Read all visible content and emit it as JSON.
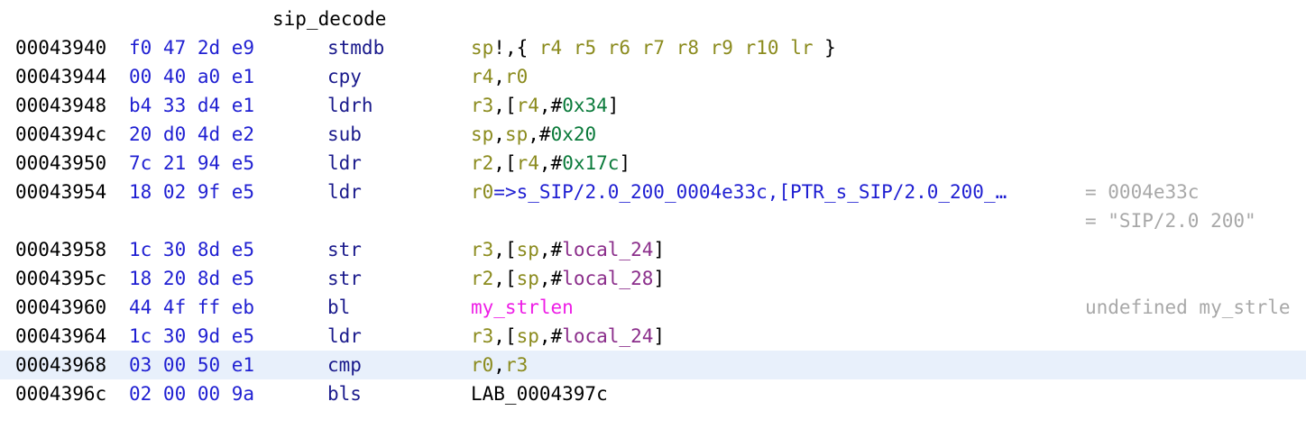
{
  "function_name": "sip_decode",
  "rows": [
    {
      "addr": "00043940",
      "bytes": "f0 47 2d e9",
      "mnemonic": "stmdb"
    },
    {
      "addr": "00043944",
      "bytes": "00 40 a0 e1",
      "mnemonic": "cpy"
    },
    {
      "addr": "00043948",
      "bytes": "b4 33 d4 e1",
      "mnemonic": "ldrh"
    },
    {
      "addr": "0004394c",
      "bytes": "20 d0 4d e2",
      "mnemonic": "sub"
    },
    {
      "addr": "00043950",
      "bytes": "7c 21 94 e5",
      "mnemonic": "ldr"
    },
    {
      "addr": "00043954",
      "bytes": "18 02 9f e5",
      "mnemonic": "ldr",
      "comment": "= 0004e33c",
      "comment2": "= \"SIP/2.0 200\""
    },
    {
      "addr": "00043958",
      "bytes": "1c 30 8d e5",
      "mnemonic": "str"
    },
    {
      "addr": "0004395c",
      "bytes": "18 20 8d e5",
      "mnemonic": "str"
    },
    {
      "addr": "00043960",
      "bytes": "44 4f ff eb",
      "mnemonic": "bl",
      "comment": "undefined my_strle"
    },
    {
      "addr": "00043964",
      "bytes": "1c 30 9d e5",
      "mnemonic": "ldr"
    },
    {
      "addr": "00043968",
      "bytes": "03 00 50 e1",
      "mnemonic": "cmp"
    },
    {
      "addr": "0004396c",
      "bytes": "02 00 00 9a",
      "mnemonic": "bls"
    }
  ],
  "operands": {
    "stmdb_base": "sp",
    "stmdb_bang": "!,{ ",
    "stmdb_regs": [
      "r4",
      "r5",
      "r6",
      "r7",
      "r8",
      "r9",
      "r10",
      "lr"
    ],
    "stmdb_close": " }",
    "r0": "r0",
    "r2": "r2",
    "r3": "r3",
    "r4": "r4",
    "sp": "sp",
    "comma": ",",
    "lbracket": "[",
    "rbracket": "]",
    "hash": "#",
    "imm_0x34": "0x34",
    "imm_0x20": "0x20",
    "imm_0x17c": "0x17c",
    "ldr_ref": "=>s_SIP/2.0_200_0004e33c,[PTR_s_SIP/2.0_200_…",
    "local_24": "local_24",
    "local_28": "local_28",
    "my_strlen": "my_strlen",
    "lab": "LAB_0004397c"
  },
  "colors": {
    "address": "#000000",
    "bytes": "#1f1fd2",
    "mnemonic": "#1a1a8c",
    "register": "#8b8b1e",
    "immediate": "#0a7a3a",
    "local_var": "#8b2e8b",
    "function_ref": "#ee1ee6",
    "comment": "#a8a8a8",
    "highlight": "#e8f0fb"
  }
}
